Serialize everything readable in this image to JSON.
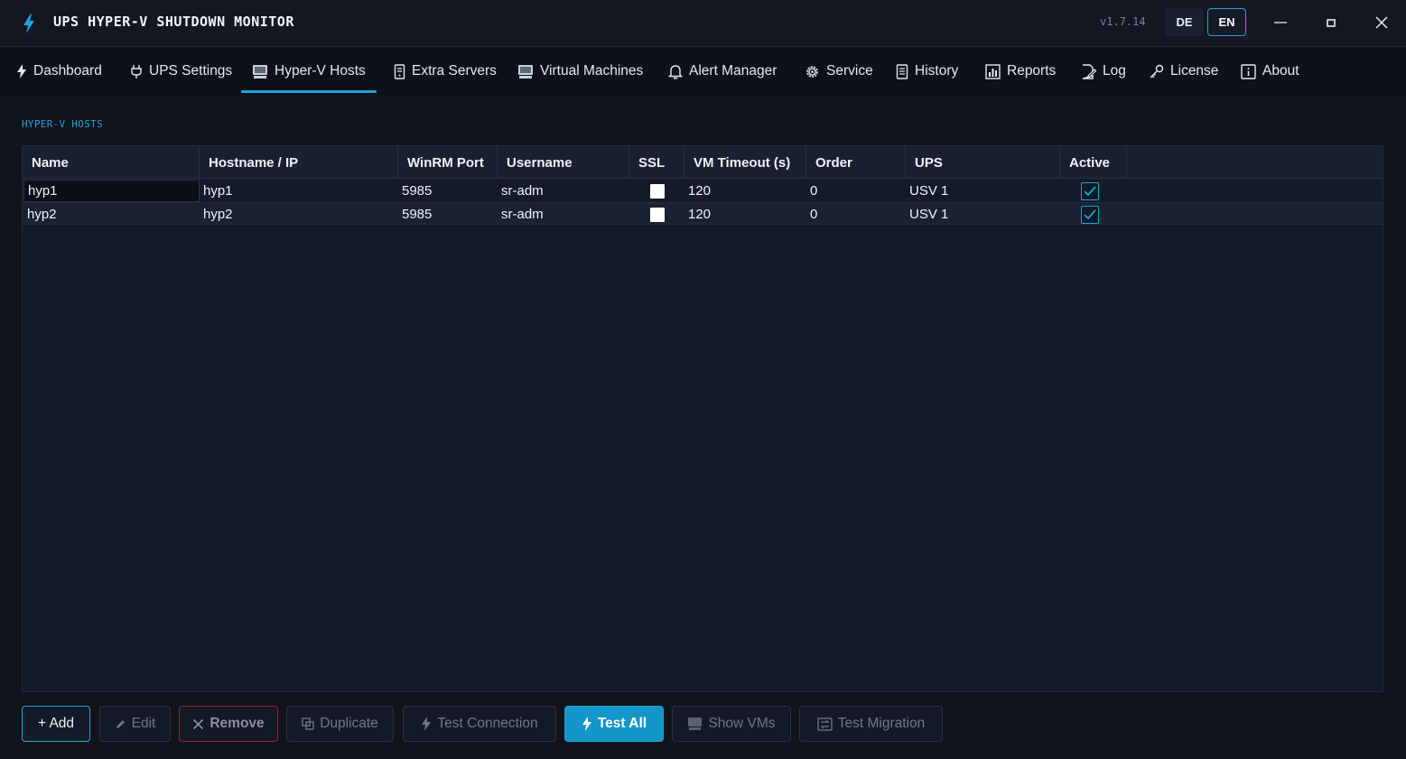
{
  "app": {
    "title": "UPS HYPER-V SHUTDOWN MONITOR",
    "version": "v1.7.14",
    "lang_options": [
      "DE",
      "EN"
    ],
    "lang_selected": "EN",
    "accent_color": "#1ba3d6"
  },
  "nav": {
    "tabs": [
      {
        "label": "Dashboard",
        "icon": "bolt-icon"
      },
      {
        "label": "UPS Settings",
        "icon": "plug-icon"
      },
      {
        "label": "Hyper-V Hosts",
        "icon": "server-icon",
        "active": true
      },
      {
        "label": "Extra Servers",
        "icon": "tower-icon"
      },
      {
        "label": "Virtual Machines",
        "icon": "monitor-icon"
      },
      {
        "label": "Alert Manager",
        "icon": "bell-icon"
      },
      {
        "label": "Service",
        "icon": "gear-icon"
      },
      {
        "label": "History",
        "icon": "list-icon"
      },
      {
        "label": "Reports",
        "icon": "chart-icon"
      },
      {
        "label": "Log",
        "icon": "edit-icon"
      },
      {
        "label": "License",
        "icon": "key-icon"
      },
      {
        "label": "About",
        "icon": "info-icon"
      }
    ]
  },
  "section_label": "HYPER-V HOSTS",
  "table": {
    "columns": [
      "Name",
      "Hostname / IP",
      "WinRM Port",
      "Username",
      "SSL",
      "VM Timeout (s)",
      "Order",
      "UPS",
      "Active"
    ],
    "rows": [
      {
        "name": "hyp1",
        "hostname": "hyp1",
        "port": "5985",
        "username": "sr-adm",
        "ssl": false,
        "timeout": "120",
        "order": "0",
        "ups": "USV 1",
        "active": true
      },
      {
        "name": "hyp2",
        "hostname": "hyp2",
        "port": "5985",
        "username": "sr-adm",
        "ssl": false,
        "timeout": "120",
        "order": "0",
        "ups": "USV 1",
        "active": true
      }
    ]
  },
  "buttons": {
    "add": "+ Add",
    "edit": "Edit",
    "remove": "Remove",
    "duplicate": "Duplicate",
    "test_connection": "Test Connection",
    "test_all": "Test All",
    "show_vms": "Show VMs",
    "test_migration": "Test Migration"
  }
}
